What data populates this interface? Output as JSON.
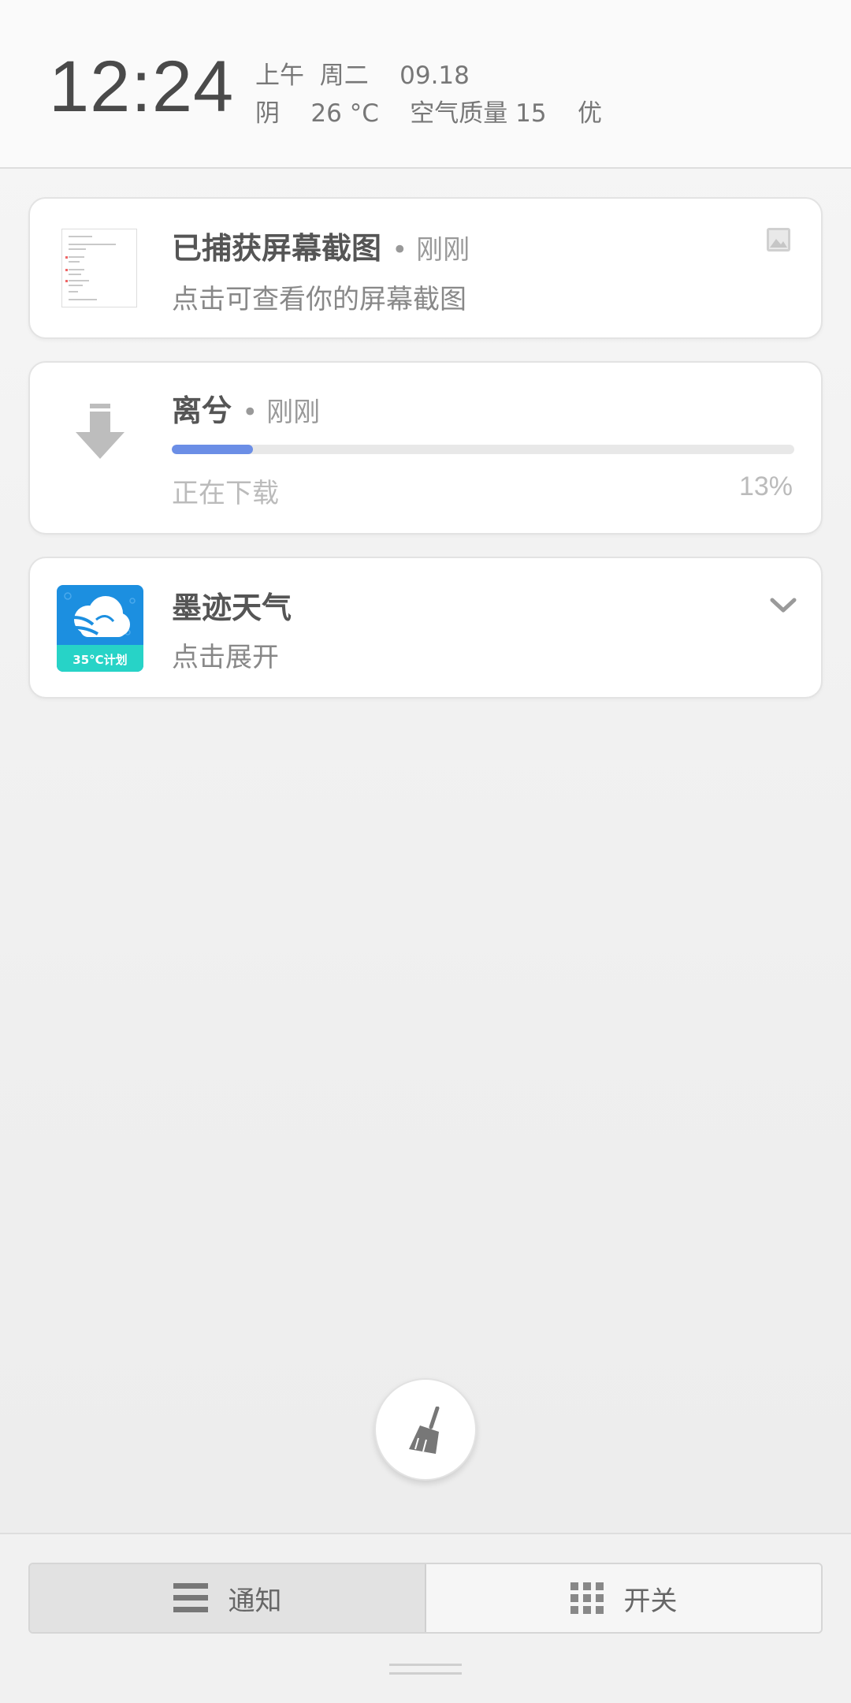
{
  "status_header": {
    "time": "12:24",
    "line1": "上午  周二    09.18",
    "line2": "阴    26 °C    空气质量 15    优"
  },
  "notifications": [
    {
      "title": "已捕获屏幕截图",
      "time": "• 刚刚",
      "subtitle": "点击可查看你的屏幕截图",
      "icon": "image-icon"
    },
    {
      "title": "离兮",
      "time": "• 刚刚",
      "status": "正在下载",
      "progress_percent": 13,
      "progress_label": "13%",
      "icon": "download-icon"
    },
    {
      "title": "墨迹天气",
      "subtitle": "点击展开",
      "app_icon_text": "35°C计划",
      "icon": "chevron-down-icon"
    }
  ],
  "clear_button": {
    "icon": "broom-icon"
  },
  "bottom_tabs": [
    {
      "label": "通知",
      "icon": "menu-icon",
      "active": true
    },
    {
      "label": "开关",
      "icon": "grid-icon",
      "active": false
    }
  ],
  "colors": {
    "progress": "#6b8ee6",
    "weather_icon_bg": "#1c8fe0",
    "weather_icon_band": "#27d3c7"
  }
}
